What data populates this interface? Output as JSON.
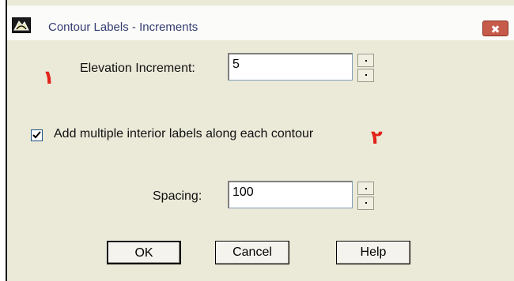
{
  "window": {
    "title": "Contour Labels - Increments",
    "close_symbol": "✖",
    "icon": "contour-app-icon"
  },
  "elevation": {
    "label": "Elevation Increment:",
    "value": "5",
    "marker": "١"
  },
  "interior_labels": {
    "checked": true,
    "label": "Add multiple interior labels along each contour",
    "marker": "٢"
  },
  "spacing": {
    "label": "Spacing:",
    "value": "100"
  },
  "buttons": {
    "ok": "OK",
    "cancel": "Cancel",
    "help": "Help"
  },
  "colors": {
    "title_text": "#333c72",
    "marker": "#e2231a",
    "close_button": "#c75b4b",
    "dialog_background": "#ebe9d8"
  }
}
